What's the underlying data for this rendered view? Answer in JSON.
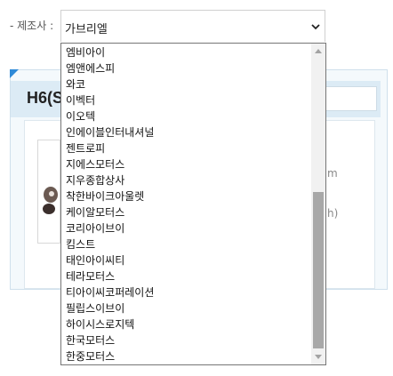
{
  "manufacturer": {
    "label": "- 제조사 :",
    "selected_value": "가브리엘"
  },
  "background": {
    "title_fragment": "H6(S",
    "right_text_1": "m",
    "right_text_2": "h)"
  },
  "dropdown": {
    "options": [
      "엠비아이",
      "엠앤에스피",
      "와코",
      "이벡터",
      "이오텍",
      "인에이블인터내셔널",
      "젠트로피",
      "지에스모터스",
      "지우종합상사",
      "착한바이크아울렛",
      "케이알모터스",
      "코리아이브이",
      "킴스트",
      "태인아이씨티",
      "테라모터스",
      "티아이씨코퍼레이션",
      "필립스이브이",
      "하이시스로지텍",
      "한국모터스",
      "한중모터스"
    ],
    "scroll_position": 0.55
  },
  "icons": {
    "select_arrow": "chevron-down-icon",
    "scroll_up": "scroll-up-arrow-icon",
    "scroll_down": "scroll-down-arrow-icon"
  },
  "colors": {
    "accent_corner": "#2e8ad8",
    "header_bg": "#dcebf5",
    "scroll_thumb": "#a8a8a8"
  }
}
